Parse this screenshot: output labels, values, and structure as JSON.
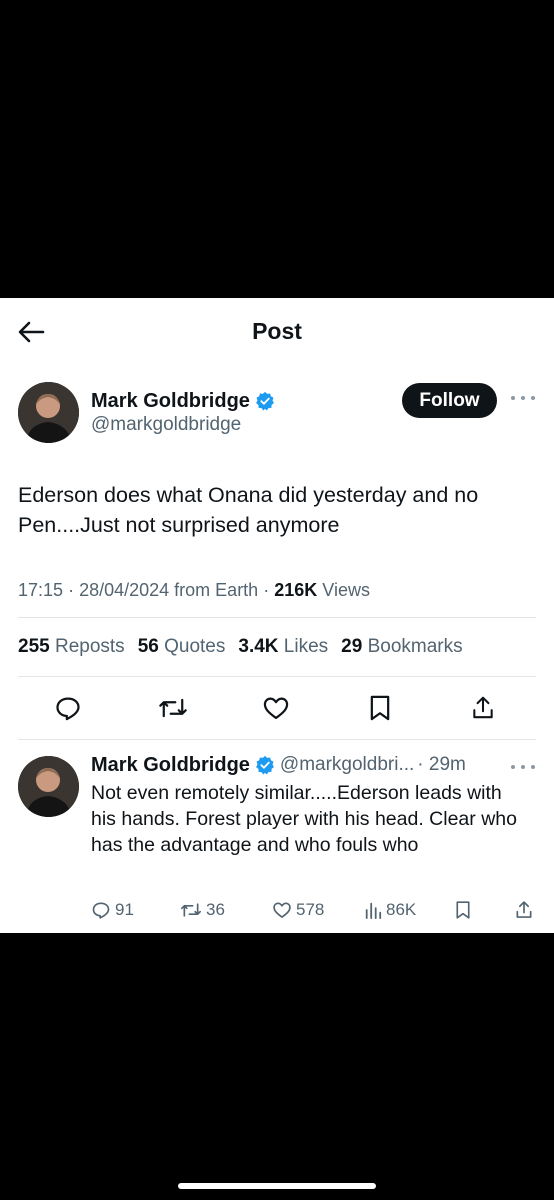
{
  "header": {
    "title": "Post"
  },
  "post": {
    "author_name": "Mark Goldbridge",
    "handle": "@markgoldbridge",
    "follow_label": "Follow",
    "text": "Ederson does what Onana did yesterday and no Pen....Just not surprised anymore",
    "time": "17:15",
    "date": "28/04/2024",
    "source": "from Earth",
    "views_count": "216K",
    "views_label": "Views"
  },
  "stats": {
    "reposts_count": "255",
    "reposts_label": "Reposts",
    "quotes_count": "56",
    "quotes_label": "Quotes",
    "likes_count": "3.4K",
    "likes_label": "Likes",
    "bookmarks_count": "29",
    "bookmarks_label": "Bookmarks"
  },
  "reply": {
    "author_name": "Mark Goldbridge",
    "handle": "@markgoldbri...",
    "time": "· 29m",
    "text": "Not even remotely similar.....Ederson leads with his hands. Forest player with his head. Clear who has the advantage and who fouls who",
    "replies": "91",
    "reposts": "36",
    "likes": "578",
    "views": "86K"
  },
  "icons": [
    "back-arrow-icon",
    "verified-badge-icon",
    "more-dots-icon",
    "reply-icon",
    "repost-icon",
    "like-icon",
    "bookmark-icon",
    "share-icon",
    "views-icon"
  ],
  "colors": {
    "verified": "#1d9bf0",
    "text": "#0f1419",
    "muted": "#536471",
    "follow_bg": "#0f1419"
  }
}
